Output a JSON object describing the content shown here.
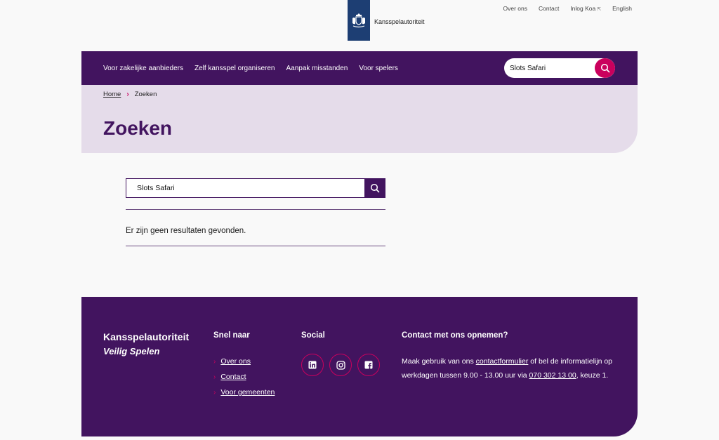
{
  "brand": {
    "name": "Kansspelautoriteit"
  },
  "top_links": [
    {
      "label": "Over ons"
    },
    {
      "label": "Contact"
    },
    {
      "label": "Inlog Koa",
      "external": true
    },
    {
      "label": "English"
    }
  ],
  "nav": {
    "items": [
      {
        "label": "Voor zakelijke aanbieders"
      },
      {
        "label": "Zelf kansspel organiseren"
      },
      {
        "label": "Aanpak misstanden"
      },
      {
        "label": "Voor spelers"
      }
    ],
    "search_value": "Slots Safari"
  },
  "breadcrumb": {
    "home": "Home",
    "current": "Zoeken"
  },
  "page_title": "Zoeken",
  "search": {
    "value": "Slots Safari"
  },
  "results_message": "Er zijn geen resultaten gevonden.",
  "footer": {
    "brand": "Kansspelautoriteit",
    "tagline": "Veilig Spelen",
    "quick_heading": "Snel naar",
    "quick_links": [
      "Over ons",
      "Contact",
      "Voor gemeenten"
    ],
    "social_heading": "Social",
    "social_icons": [
      "linkedin-icon",
      "instagram-icon",
      "facebook-icon"
    ],
    "contact_heading": "Contact met ons opnemen?",
    "contact_pre": "Maak gebruik van ons ",
    "contact_link": "contactformulier",
    "contact_mid": " of bel de informatielijn op werkdagen tussen 9.00 - 13.00 uur via ",
    "contact_phone": "070 302 13 00",
    "contact_post": ", keuze 1."
  },
  "colors": {
    "brand_purple": "#42145f",
    "accent_pink": "#ca005d",
    "hero_bg": "#e5dcea",
    "logo_blue": "#1d3e73"
  }
}
